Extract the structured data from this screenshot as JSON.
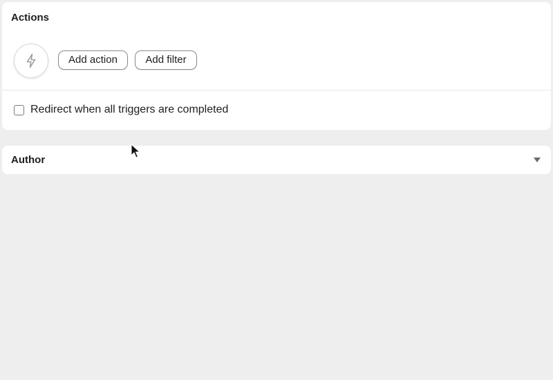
{
  "actions_panel": {
    "title": "Actions",
    "bolt_icon": "lightning-bolt-icon",
    "add_action_label": "Add action",
    "add_filter_label": "Add filter",
    "redirect_checkbox": {
      "label": "Redirect when all triggers are completed",
      "checked": false
    }
  },
  "author_panel": {
    "title": "Author",
    "expand_icon": "caret-down-icon",
    "expanded": false
  },
  "cursor": {
    "icon": "mouse-pointer-icon"
  },
  "colors": {
    "background": "#eeeeee",
    "panel": "#ffffff",
    "text": "#1e1e1e"
  }
}
